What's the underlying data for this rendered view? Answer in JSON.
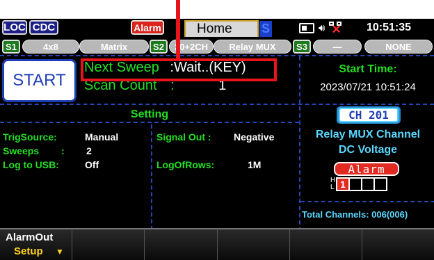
{
  "topbar": {
    "loc": "LOC",
    "cdc": "CDC",
    "alarm": "Alarm",
    "home": "Home",
    "home_badge": "S",
    "clock": "10:51:35"
  },
  "slots": [
    {
      "label": "S1",
      "value": "4x8"
    },
    {
      "label": "",
      "value": "Matrix"
    },
    {
      "label": "S2",
      "value": "20+2CH"
    },
    {
      "label": "",
      "value": "Relay MUX"
    },
    {
      "label": "S3",
      "value": "—"
    },
    {
      "label": "",
      "value": "NONE"
    }
  ],
  "info": {
    "start_button": "START",
    "next_sweep_label": "Next Sweep",
    "next_sweep_value": ":Wait..(KEY)",
    "scan_count_label": "Scan Count",
    "scan_count_sep": ":",
    "scan_count_value": "1",
    "start_time_label": "Start Time:",
    "start_time_value": "2023/07/21 10:51:24"
  },
  "setting": {
    "title": "Setting",
    "trig_source_label": "TrigSource:",
    "trig_source_value": "Manual",
    "sweeps_label": "Sweeps",
    "sweeps_sep": ":",
    "sweeps_value": "2",
    "log_usb_label": "Log to USB:",
    "log_usb_value": "Off",
    "signal_out_label": "Signal Out :",
    "signal_out_value": "Negative",
    "log_rows_label": "LogOfRows:",
    "log_rows_value": "1M"
  },
  "channel": {
    "id": "CH 201",
    "desc1": "Relay MUX Channel",
    "desc2": "DC Voltage",
    "alarm_label": "Alarm",
    "h_label": "H",
    "l_label": "L",
    "cells": [
      "1",
      "",
      "",
      ""
    ],
    "total_label": "Total Channels: 006(006)"
  },
  "softkeys": [
    {
      "top": "AlarmOut",
      "bottom": "Setup"
    },
    {
      "top": "",
      "bottom": ""
    },
    {
      "top": "",
      "bottom": ""
    },
    {
      "top": "",
      "bottom": ""
    },
    {
      "top": "",
      "bottom": ""
    },
    {
      "top": "",
      "bottom": ""
    }
  ],
  "colors": {
    "annotation": "#e8141b",
    "label_green": "#22e022",
    "channel_cyan": "#5ad8ff",
    "alarm_red": "#d9231c",
    "softkey_yellow": "#ffd321"
  }
}
